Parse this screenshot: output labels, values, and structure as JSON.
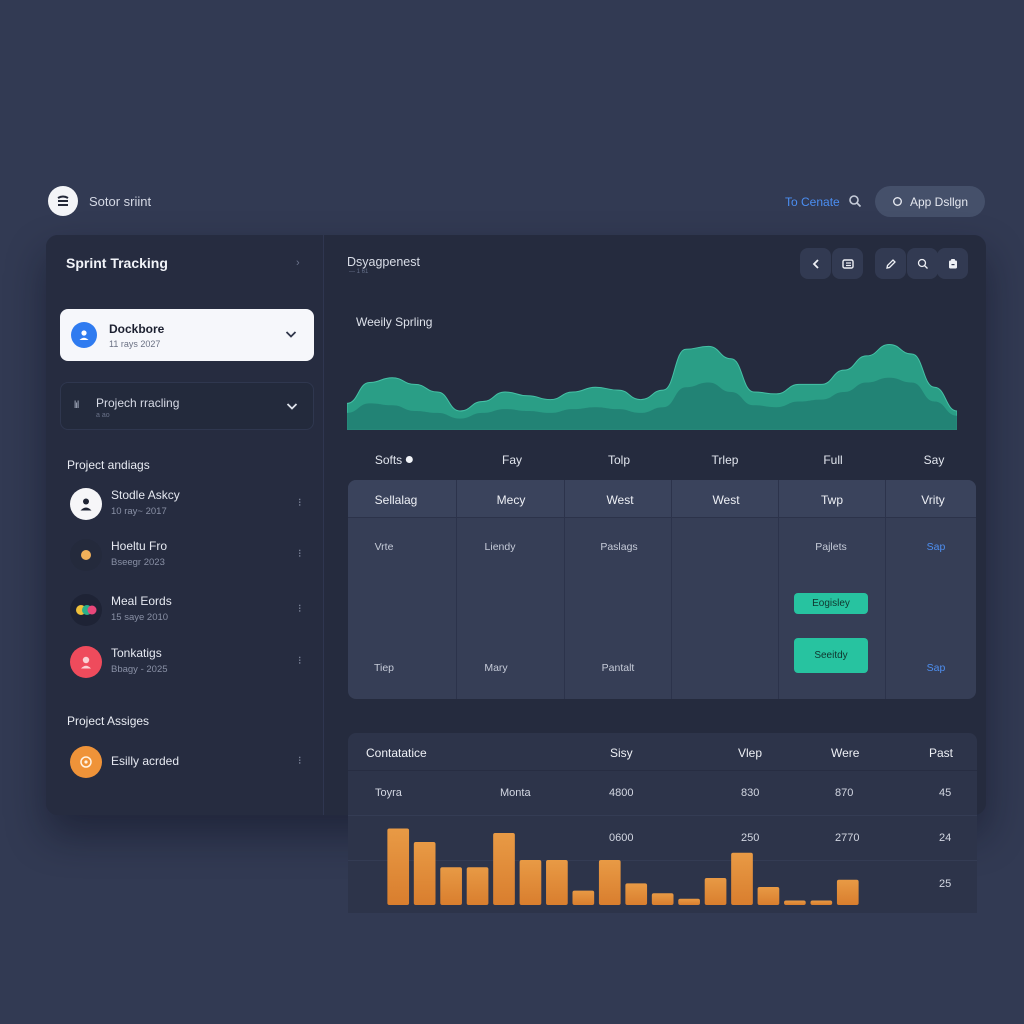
{
  "topbar": {
    "brand_name": "Sotor sriint",
    "link_label": "To Cenate",
    "search_icon": "search-icon",
    "pill_label": "App Dsllgn",
    "pill_icon": "search-icon"
  },
  "sidebar": {
    "title": "Sprint Tracking",
    "collapse_glyph": "›",
    "workspace": {
      "name": "Dockbore",
      "sub": "11 rays 2027",
      "icon": "user-icon"
    },
    "filter": {
      "icon_glyph": "lıl",
      "label": "Projech rracling",
      "sub": "a ao"
    },
    "section1": "Project andiags",
    "projects": [
      {
        "name": "Stodle Askcy",
        "sub": "10 ray~ 2017",
        "avatar_color": "#f6f6f8",
        "more": "⁝"
      },
      {
        "name": "Hoeltu Fro",
        "sub": "Bseegr 2023",
        "avatar_color": "#242a3c",
        "more": "⁝"
      },
      {
        "name": "Meal Eords",
        "sub": "15 saye 2010",
        "avatar_color": "#1e2335",
        "more": "⁝"
      },
      {
        "name": "Tonkatigs",
        "sub": "Bbagy - 2025",
        "avatar_color": "#ef4b5c",
        "more": "⁝"
      }
    ],
    "section2": "Project Assiges",
    "assignee": {
      "name": "Esilly acrded",
      "avatar_color": "#ef9339",
      "more": "⁝"
    }
  },
  "main": {
    "title": "Dsyagpenest",
    "subtitle": "— 1 61",
    "toolbar": [
      "back-icon",
      "list-icon",
      "edit-icon",
      "tag-icon",
      "clipboard-icon"
    ],
    "chart_label": "Weeily Sprling",
    "days": [
      "Softs",
      "Fay",
      "Tolp",
      "Trlep",
      "Full",
      "Say"
    ],
    "schedule": {
      "headers": [
        "Sellalag",
        "Mecy",
        "West",
        "West",
        "Twp",
        "Vrity"
      ],
      "row1": [
        "Vrte",
        "Liendy",
        "Paslags",
        "",
        "Pajlets",
        "Sap"
      ],
      "badge1": "Eogisley",
      "row3": [
        "Tiep",
        "Mary",
        "Pantalt",
        "",
        "",
        "Sap"
      ],
      "badge2": "Seeitdy"
    }
  },
  "stats": {
    "headers": [
      "Contatatice",
      "Sisy",
      "Vlep",
      "Were",
      "Past"
    ],
    "row1": [
      "Toyra",
      "Monta",
      "4800",
      "830",
      "870",
      "45"
    ],
    "row2": [
      "0600",
      "250",
      "2770",
      "24"
    ],
    "row3": [
      "25"
    ]
  },
  "chart_data": [
    {
      "type": "area",
      "title": "Weeily Sprling",
      "series": [
        {
          "values": [
            0.28,
            0.5,
            0.55,
            0.48,
            0.4,
            0.2,
            0.3,
            0.4,
            0.36,
            0.32,
            0.4,
            0.45,
            0.42,
            0.32,
            0.42,
            0.85,
            0.88,
            0.75,
            0.4,
            0.38,
            0.48,
            0.48,
            0.63,
            0.78,
            0.9,
            0.8,
            0.45,
            0.2
          ]
        },
        {
          "values": [
            0.18,
            0.28,
            0.26,
            0.2,
            0.18,
            0.12,
            0.18,
            0.22,
            0.2,
            0.18,
            0.22,
            0.24,
            0.22,
            0.18,
            0.24,
            0.45,
            0.5,
            0.4,
            0.26,
            0.24,
            0.3,
            0.32,
            0.4,
            0.5,
            0.55,
            0.5,
            0.3,
            0.15
          ]
        }
      ],
      "colors": [
        "#2a9e86",
        "#207a6f"
      ]
    },
    {
      "type": "bar",
      "values": [
        85,
        70,
        42,
        42,
        80,
        50,
        50,
        16,
        50,
        24,
        13,
        7,
        30,
        58,
        20,
        5,
        5,
        28
      ],
      "colors": [
        "#e89a45",
        "#d97e2e"
      ]
    }
  ]
}
